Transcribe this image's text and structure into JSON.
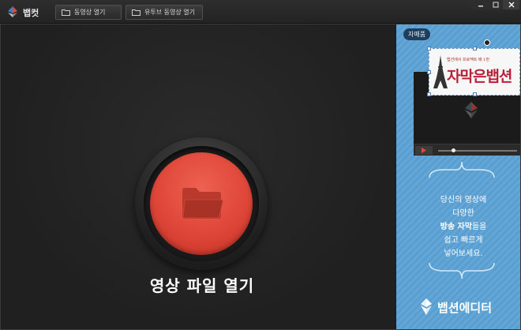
{
  "titlebar": {
    "app_name": "뱁컷",
    "open_video_label": "동영상 열기",
    "open_youtube_label": "유투브 동영상 열기"
  },
  "main": {
    "open_file_label": "영상 파일 열기"
  },
  "ad": {
    "tag": "자매품",
    "subtitle_small": "뱁션에서 프로젝트 배 1번",
    "subtitle_big": "자막은뱁션",
    "line1": "당신의 영상에",
    "line2": "다양한",
    "line3_bold": "방송 자막",
    "line3_rest": "들을",
    "line4": "쉽고 빠르게",
    "line5": "넣어보세요.",
    "brand_name": "뱁션에디터"
  },
  "colors": {
    "accent_red": "#de4638",
    "ad_blue": "#5a9ed0",
    "background": "#202020"
  }
}
